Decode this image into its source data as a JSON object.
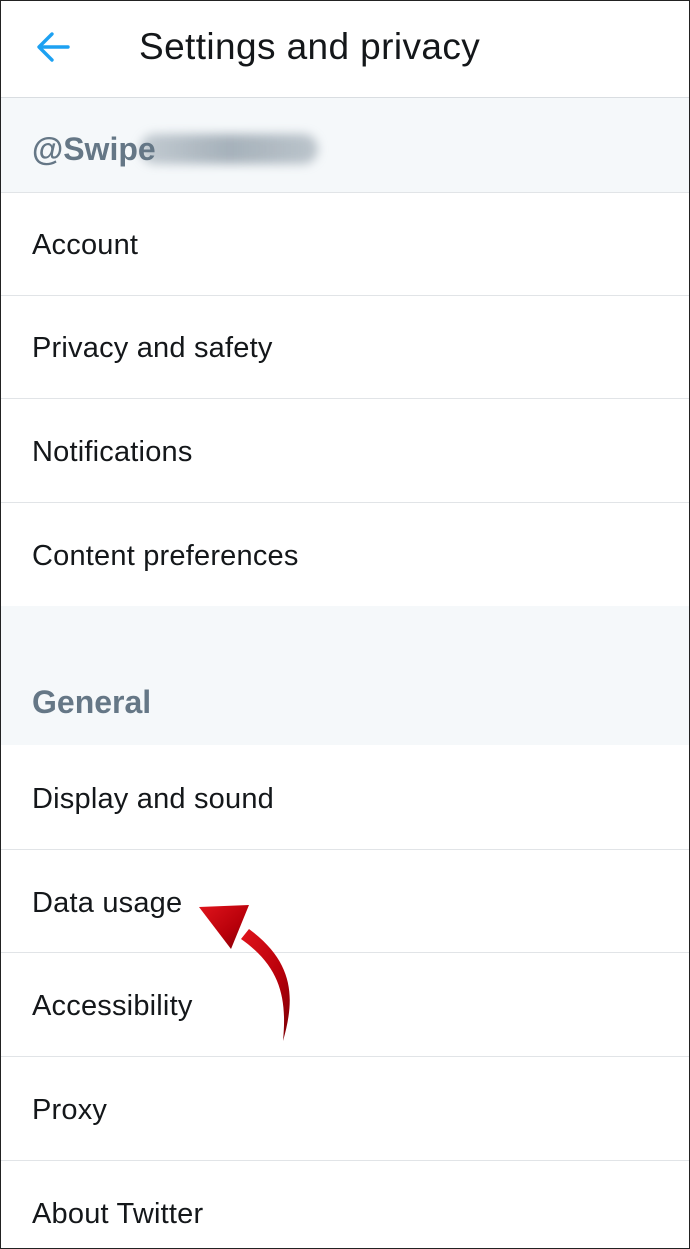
{
  "header": {
    "title": "Settings and privacy",
    "back_icon": "arrow-left-icon",
    "accent_color": "#1da1f2"
  },
  "account_section": {
    "handle": "@Swipe",
    "handle_obscured": true
  },
  "account_items": [
    {
      "label": "Account"
    },
    {
      "label": "Privacy and safety"
    },
    {
      "label": "Notifications"
    },
    {
      "label": "Content preferences"
    }
  ],
  "general_section": {
    "title": "General"
  },
  "general_items": [
    {
      "label": "Display and sound"
    },
    {
      "label": "Data usage"
    },
    {
      "label": "Accessibility"
    },
    {
      "label": "Proxy"
    },
    {
      "label": "About Twitter"
    }
  ],
  "annotation": {
    "type": "red-curved-arrow",
    "points_to": "Data usage",
    "color": "#c0000b"
  },
  "colors": {
    "section_bg": "#f5f8fa",
    "section_text": "#657786",
    "divider": "#e1e4e7",
    "text": "#14171a"
  }
}
